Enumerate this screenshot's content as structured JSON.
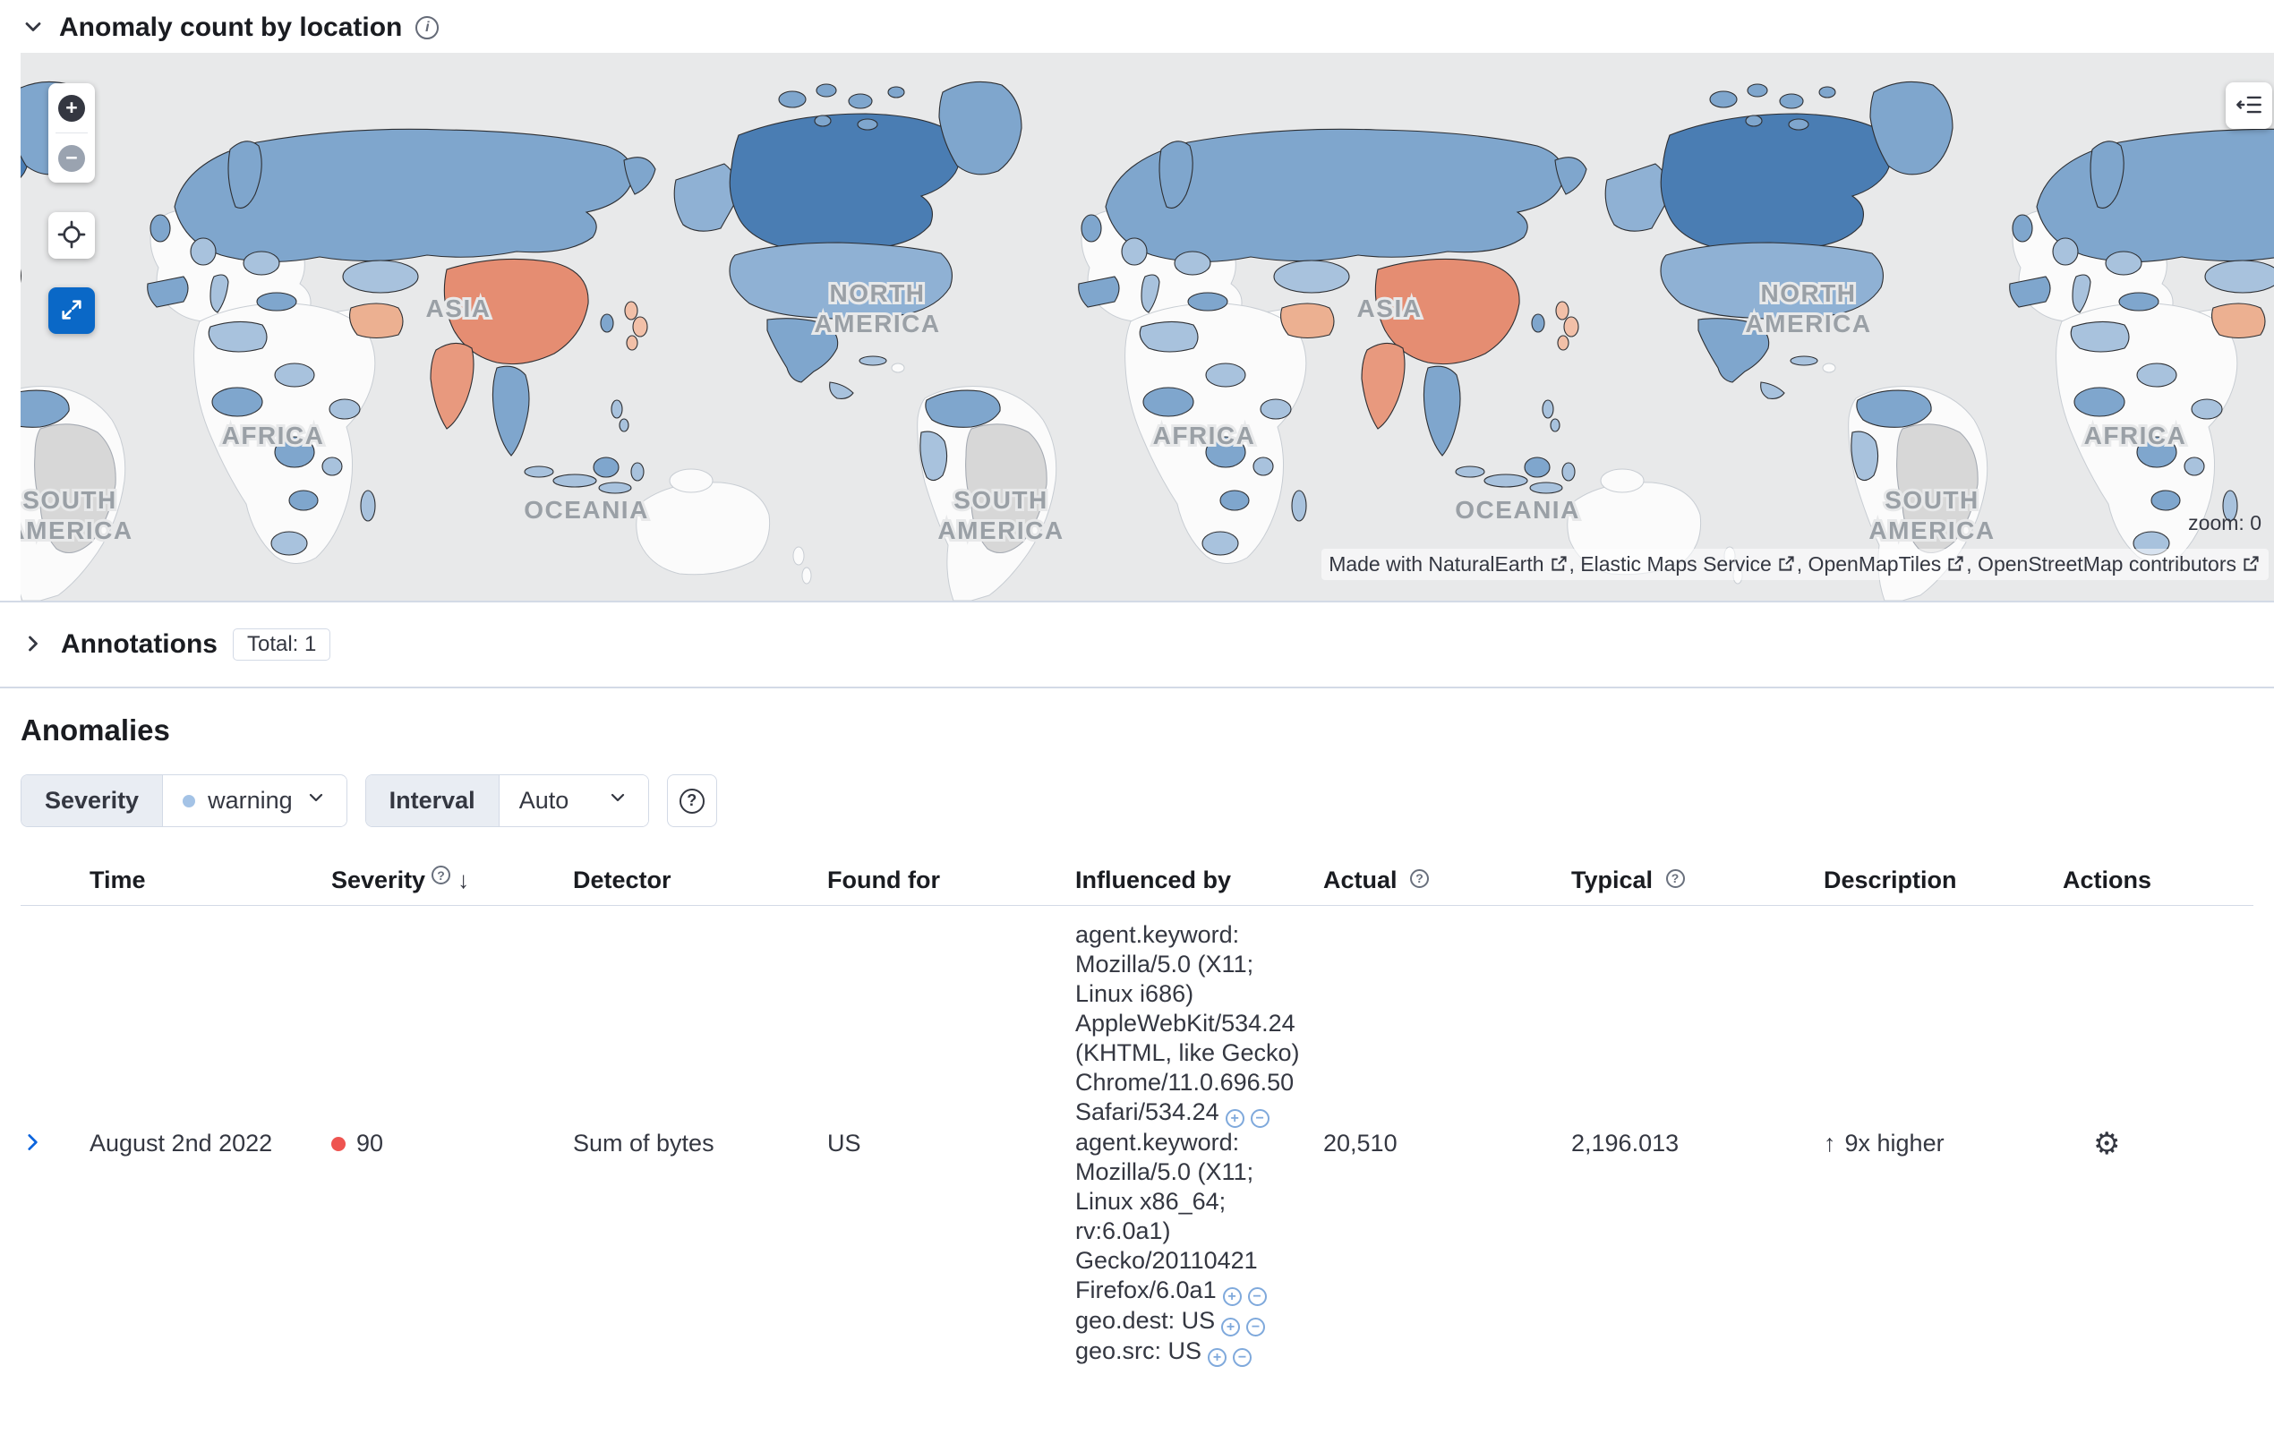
{
  "colors": {
    "primary_blue": "#0b64dd",
    "text": "#343741",
    "heading": "#1a1c21",
    "border": "#d3dae6",
    "severity_critical_dot": "#ee5450",
    "severity_warning_dot": "#a4c3e6",
    "map_expand_button": "#0a68c7",
    "map_high_anomaly": "#e58d72",
    "map_low_anomaly": "#7fa6cd",
    "map_no_data_land": "#fbfbfb",
    "map_ocean": "#e8e9ea"
  },
  "icons": {
    "plus": "+",
    "minus": "−",
    "sort_desc": "↓",
    "arrow_up": "↑",
    "gear": "⚙",
    "info_i": "i",
    "question": "?"
  },
  "map_panel": {
    "title": "Anomaly count by location",
    "zoom_label": "zoom: 0",
    "geo_labels": {
      "asia": "ASIA",
      "north_america_line1": "NORTH",
      "north_america_line2": "AMERICA",
      "africa": "AFRICA",
      "oceania": "OCEANIA",
      "south_america_line1": "SOUTH",
      "south_america_line2": "AMERICA"
    },
    "attribution": [
      {
        "label": "Made with NaturalEarth"
      },
      {
        "label": ", Elastic Maps Service"
      },
      {
        "label": ", OpenMapTiles"
      },
      {
        "label": ", OpenStreetMap contributors"
      }
    ]
  },
  "annotations_panel": {
    "title": "Annotations",
    "badge": "Total: 1"
  },
  "anomalies": {
    "title": "Anomalies",
    "filters": {
      "severity_label": "Severity",
      "severity_value": "warning",
      "interval_label": "Interval",
      "interval_value": "Auto"
    },
    "table": {
      "headers": {
        "time": "Time",
        "severity": "Severity",
        "detector": "Detector",
        "found_for": "Found for",
        "influenced_by": "Influenced by",
        "actual": "Actual",
        "typical": "Typical",
        "description": "Description",
        "actions": "Actions"
      },
      "row": {
        "time": "August 2nd 2022",
        "severity": "90",
        "detector": "Sum of bytes",
        "found_for": "US",
        "influencers": [
          "agent.keyword: Mozilla/5.0 (X11; Linux i686) AppleWebKit/534.24 (KHTML, like Gecko) Chrome/11.0.696.50 Safari/534.24",
          "agent.keyword: Mozilla/5.0 (X11; Linux x86_64; rv:6.0a1) Gecko/20110421 Firefox/6.0a1",
          "geo.dest: US",
          "geo.src: US"
        ],
        "actual": "20,510",
        "typical": "2,196.013",
        "description": "9x higher"
      }
    }
  }
}
